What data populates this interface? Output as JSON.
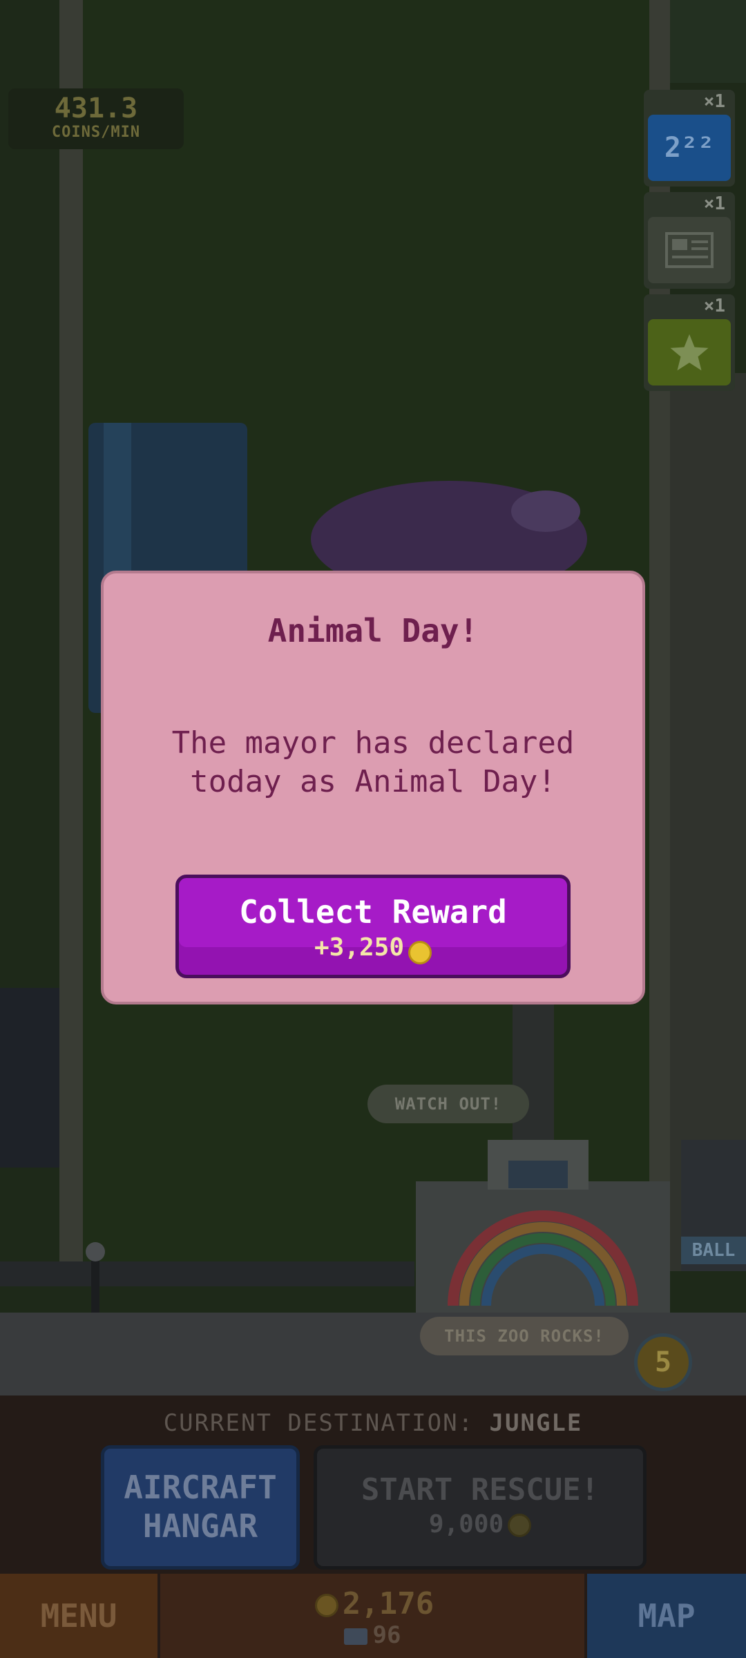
{
  "hud": {
    "rate_value": "431.3",
    "rate_label": "COINS/MIN"
  },
  "boosts": [
    {
      "multiplier": "×1",
      "label": "2²²",
      "icon": "exponent-icon",
      "color": "#1a62b2"
    },
    {
      "multiplier": "×1",
      "label": "",
      "icon": "newspaper-icon",
      "color": "#3c4238"
    },
    {
      "multiplier": "×1",
      "label": "",
      "icon": "star-icon",
      "color": "#5d7a1d"
    }
  ],
  "modal": {
    "title": "Animal Day!",
    "message": "The mayor has declared today as Animal Day!",
    "button_label": "Collect Reward",
    "reward_amount": "+3,250",
    "reward_icon": "coin-icon"
  },
  "scene": {
    "bubble_watch": "WATCH OUT!",
    "bubble_zoo": "THIS ZOO ROCKS!",
    "sign_text": "BALL",
    "level_badge": "5"
  },
  "bottom": {
    "destination_label": "CURRENT DESTINATION:",
    "destination_value": "JUNGLE",
    "hangar_line1": "AIRCRAFT",
    "hangar_line2": "HANGAR",
    "rescue_label": "START RESCUE!",
    "rescue_cost": "9,000",
    "menu_label": "MENU",
    "coins": "2,176",
    "tickets": "96",
    "map_label": "MAP"
  },
  "colors": {
    "modal_bg": "#dc9db1",
    "modal_text": "#6e1f4e",
    "collect_button": "#a61bc7",
    "hangar_button": "#213a66",
    "map_button": "#1e3859",
    "menu_button": "#4c2e16"
  }
}
